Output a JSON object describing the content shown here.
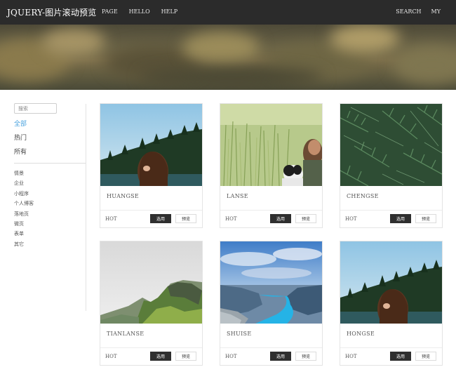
{
  "navbar": {
    "brand": "JQUERY-图片滚动预览",
    "left_links": [
      "PAGE",
      "HELLO",
      "HELP"
    ],
    "right_links": [
      "SEARCH",
      "MY"
    ]
  },
  "sidebar": {
    "search_placeholder": "搜索",
    "main_categories": [
      {
        "label": "全部",
        "active": true
      },
      {
        "label": "热门",
        "active": false
      },
      {
        "label": "所有",
        "active": false
      }
    ],
    "sub_categories": [
      "情景",
      "企业",
      "小程序",
      "个人博客",
      "落地页",
      "微页",
      "表单",
      "其它"
    ]
  },
  "cards": [
    {
      "title": "HUANGSE",
      "tag": "HOT",
      "select_label": "选用",
      "preview_label": "预览",
      "scene": "woman-forest"
    },
    {
      "title": "LANSE",
      "tag": "HOT",
      "select_label": "选用",
      "preview_label": "预览",
      "scene": "meadow-dog"
    },
    {
      "title": "CHENGSE",
      "tag": "HOT",
      "select_label": "选用",
      "preview_label": "预览",
      "scene": "pine-branches"
    },
    {
      "title": "TIANLANSE",
      "tag": "HOT",
      "select_label": "选用",
      "preview_label": "预览",
      "scene": "green-mountain"
    },
    {
      "title": "SHUISE",
      "tag": "HOT",
      "select_label": "选用",
      "preview_label": "预览",
      "scene": "fjord-lake"
    },
    {
      "title": "HONGSE",
      "tag": "HOT",
      "select_label": "选用",
      "preview_label": "预览",
      "scene": "woman-forest"
    }
  ],
  "colors": {
    "navbar_bg": "#2b2b2b",
    "active_category": "#4aa3df",
    "select_button": "#2f2f2f"
  }
}
